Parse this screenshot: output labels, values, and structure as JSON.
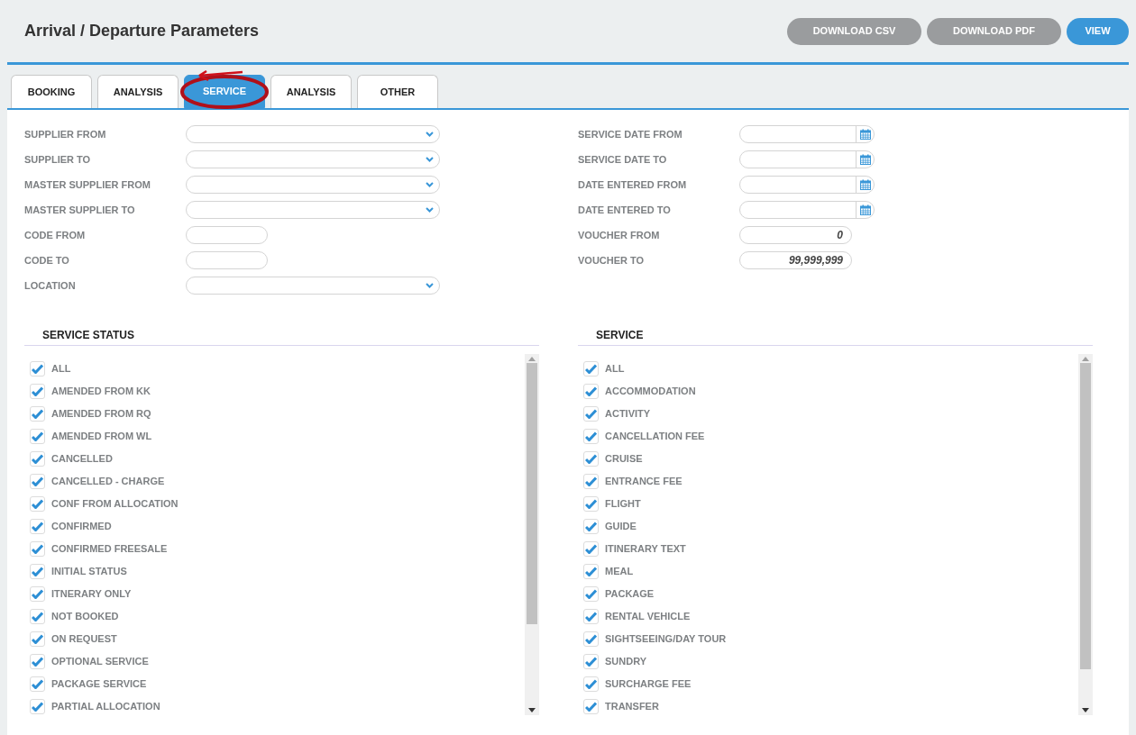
{
  "title": "Arrival / Departure Parameters",
  "buttons": [
    {
      "label": "DOWNLOAD CSV",
      "kind": "secondary"
    },
    {
      "label": "DOWNLOAD PDF",
      "kind": "secondary"
    },
    {
      "label": "VIEW",
      "kind": "primary"
    }
  ],
  "tabs": [
    {
      "label": "BOOKING",
      "selected": false,
      "annotated": false
    },
    {
      "label": "ANALYSIS",
      "selected": false,
      "annotated": false
    },
    {
      "label": "SERVICE",
      "selected": true,
      "annotated": true
    },
    {
      "label": "ANALYSIS",
      "selected": false,
      "annotated": false
    },
    {
      "label": "OTHER",
      "selected": false,
      "annotated": false
    }
  ],
  "left_fields": [
    {
      "label": "SUPPLIER FROM",
      "kind": "select"
    },
    {
      "label": "SUPPLIER TO",
      "kind": "select"
    },
    {
      "label": "MASTER SUPPLIER FROM",
      "kind": "select"
    },
    {
      "label": "MASTER SUPPLIER TO",
      "kind": "select"
    },
    {
      "label": "CODE FROM",
      "kind": "text"
    },
    {
      "label": "CODE TO",
      "kind": "text"
    },
    {
      "label": "LOCATION",
      "kind": "select"
    }
  ],
  "right_fields": [
    {
      "label": "SERVICE DATE FROM",
      "kind": "date"
    },
    {
      "label": "SERVICE DATE TO",
      "kind": "date"
    },
    {
      "label": "DATE ENTERED FROM",
      "kind": "date"
    },
    {
      "label": "DATE ENTERED TO",
      "kind": "date"
    },
    {
      "label": "VOUCHER FROM",
      "kind": "number",
      "value": "0"
    },
    {
      "label": "VOUCHER TO",
      "kind": "number",
      "value": "99,999,999"
    }
  ],
  "lists": [
    {
      "title": "SERVICE STATUS",
      "items": [
        {
          "label": "ALL",
          "checked": true
        },
        {
          "label": "AMENDED FROM KK",
          "checked": true
        },
        {
          "label": "AMENDED FROM RQ",
          "checked": true
        },
        {
          "label": "AMENDED FROM WL",
          "checked": true
        },
        {
          "label": "CANCELLED",
          "checked": true
        },
        {
          "label": "CANCELLED - CHARGE",
          "checked": true
        },
        {
          "label": "CONF FROM ALLOCATION",
          "checked": true
        },
        {
          "label": "CONFIRMED",
          "checked": true
        },
        {
          "label": "CONFIRMED FREESALE",
          "checked": true
        },
        {
          "label": "INITIAL STATUS",
          "checked": true
        },
        {
          "label": "ITNERARY ONLY",
          "checked": true
        },
        {
          "label": "NOT BOOKED",
          "checked": true
        },
        {
          "label": "ON REQUEST",
          "checked": true
        },
        {
          "label": "OPTIONAL SERVICE",
          "checked": true
        },
        {
          "label": "PACKAGE SERVICE",
          "checked": true
        },
        {
          "label": "PARTIAL ALLOCATION",
          "checked": true
        }
      ]
    },
    {
      "title": "SERVICE",
      "items": [
        {
          "label": "ALL",
          "checked": true
        },
        {
          "label": "ACCOMMODATION",
          "checked": true
        },
        {
          "label": "ACTIVITY",
          "checked": true
        },
        {
          "label": "CANCELLATION FEE",
          "checked": true
        },
        {
          "label": "CRUISE",
          "checked": true
        },
        {
          "label": "ENTRANCE FEE",
          "checked": true
        },
        {
          "label": "FLIGHT",
          "checked": true
        },
        {
          "label": "GUIDE",
          "checked": true
        },
        {
          "label": "ITINERARY TEXT",
          "checked": true
        },
        {
          "label": "MEAL",
          "checked": true
        },
        {
          "label": "PACKAGE",
          "checked": true
        },
        {
          "label": "RENTAL VEHICLE",
          "checked": true
        },
        {
          "label": "SIGHTSEEING/DAY TOUR",
          "checked": true
        },
        {
          "label": "SUNDRY",
          "checked": true
        },
        {
          "label": "SURCHARGE FEE",
          "checked": true
        },
        {
          "label": "TRANSFER",
          "checked": true
        }
      ]
    }
  ]
}
